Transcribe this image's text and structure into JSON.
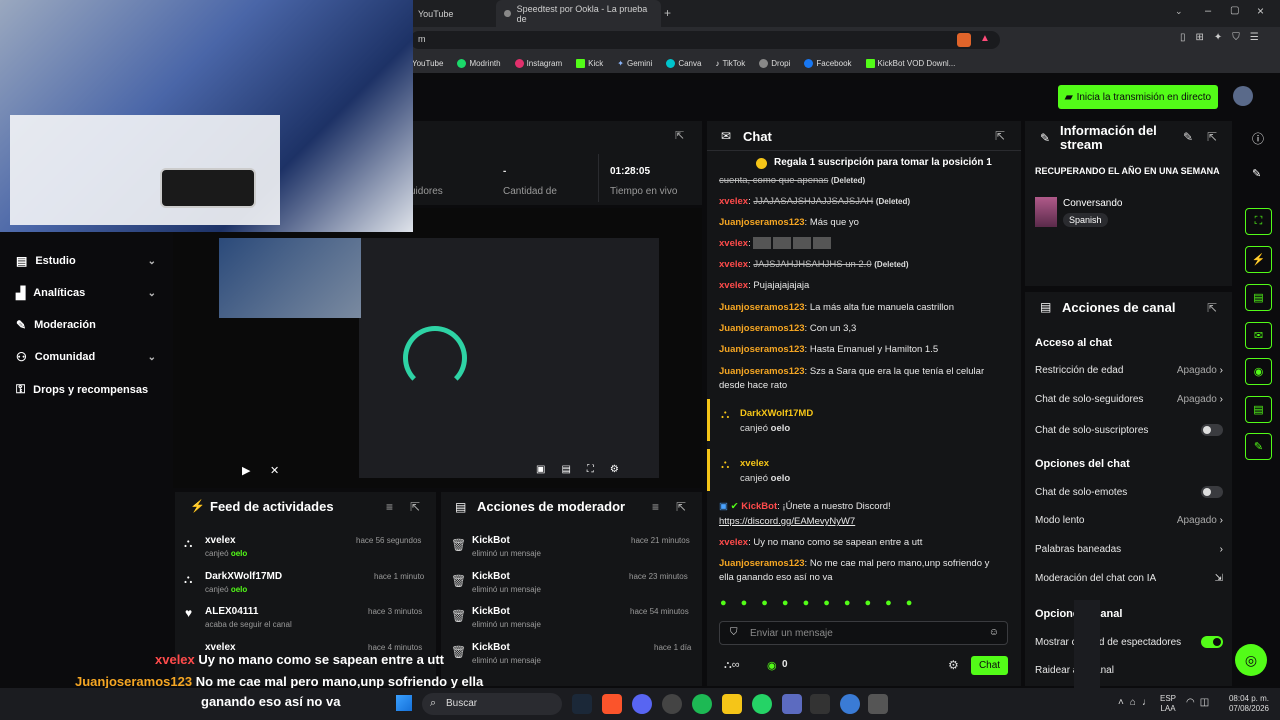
{
  "browser": {
    "tab1": "YouTube",
    "tab2": "Speedtest por Ookla - La prueba de",
    "url": "m",
    "bookmarks": [
      "YouTube",
      "Modrinth",
      "Instagram",
      "Kick",
      "Gemini",
      "Canva",
      "TikTok",
      "Dropi",
      "Facebook",
      "KickBot VOD Downl..."
    ]
  },
  "header": {
    "go_live": "Inicia la transmisión en directo"
  },
  "sidebar": {
    "items": [
      {
        "label": "Estudio",
        "chev": true
      },
      {
        "label": "Analíticas",
        "chev": true
      },
      {
        "label": "Moderación",
        "chev": false
      },
      {
        "label": "Comunidad",
        "chev": true
      },
      {
        "label": "Drops y recompensas",
        "chev": false
      }
    ]
  },
  "stats": {
    "followers_label": "uidores",
    "dash": "-",
    "count_label": "Cantidad de",
    "time_value": "01:28:05",
    "time_label": "Tiempo en vivo"
  },
  "feed": {
    "title": "Feed de actividades",
    "items": [
      {
        "name": "xvelex",
        "action": "canjeó",
        "reward": "oelo",
        "time": "hace 56 segundos"
      },
      {
        "name": "DarkXWolf17MD",
        "action": "canjeó",
        "reward": "oelo",
        "time": "hace 1 minuto"
      },
      {
        "name": "ALEX04111",
        "action": "acaba de seguir el canal",
        "reward": "",
        "time": "hace 3 minutos"
      },
      {
        "name": "xvelex",
        "action": "",
        "reward": "",
        "time": "hace 4 minutos"
      }
    ]
  },
  "modactions": {
    "title": "Acciones de moderador",
    "items": [
      {
        "name": "KickBot",
        "action": "eliminó un mensaje",
        "time": "hace 21 minutos"
      },
      {
        "name": "KickBot",
        "action": "eliminó un mensaje",
        "time": "hace 23 minutos"
      },
      {
        "name": "KickBot",
        "action": "eliminó un mensaje",
        "time": "hace 54 minutos"
      },
      {
        "name": "KickBot",
        "action": "eliminó un mensaje",
        "time": "hace 1 día"
      }
    ]
  },
  "chat": {
    "title": "Chat",
    "pinned": "Regala 1 suscripción para tomar la posición 1",
    "deleted_tag": "(Deleted)",
    "messages": [
      {
        "user": "",
        "text": "cuenta, como que apenas",
        "deleted": true
      },
      {
        "user": "xvelex",
        "text": "JJAJASAJSHJAJJSAJSJAH",
        "deleted": true
      },
      {
        "user": "Juanjoseramos123",
        "text": "Más que yo",
        "deleted": false
      },
      {
        "user": "xvelex",
        "text": "",
        "deleted": false
      },
      {
        "user": "xvelex",
        "text": "JAJSJAHJHSAHJHS un 2.0",
        "deleted": true
      },
      {
        "user": "xvelex",
        "text": "Pujajajajajaja",
        "deleted": false
      },
      {
        "user": "Juanjoseramos123",
        "text": "La más alta fue manuela castrillon",
        "deleted": false
      },
      {
        "user": "Juanjoseramos123",
        "text": "Con un 3,3",
        "deleted": false
      },
      {
        "user": "Juanjoseramos123",
        "text": "Hasta Emanuel y Hamilton 1.5",
        "deleted": false
      },
      {
        "user": "Juanjoseramos123",
        "text": "Szs a Sara que era la que tenía el celular desde hace rato",
        "deleted": false
      }
    ],
    "redeems": [
      {
        "user": "DarkXWolf17MD",
        "action": "canjeó",
        "reward": "oelo"
      },
      {
        "user": "xvelex",
        "action": "canjeó",
        "reward": "oelo"
      }
    ],
    "bot": {
      "user": "KickBot",
      "text": "¡Únete a nuestro Discord!",
      "link": "https://discord.gg/EAMevyNyW7"
    },
    "after": [
      {
        "user": "xvelex",
        "text": "Uy no mano como se sapean entre a utt"
      },
      {
        "user": "Juanjoseramos123",
        "text": "No me cae mal pero mano,unp sofriendo y ella ganando eso así no va"
      }
    ],
    "placeholder": "Enviar un mensaje",
    "points": "0",
    "send": "Chat"
  },
  "streaminfo": {
    "title": "Información del stream",
    "stream_title": "RECUPERANDO EL AÑO EN UNA SEMANA",
    "category": "Conversando",
    "language": "Spanish"
  },
  "channel": {
    "title": "Acciones de canal",
    "chat_access": "Acceso al chat",
    "rows1": [
      {
        "label": "Restricción de edad",
        "value": "Apagado",
        "type": "chev"
      },
      {
        "label": "Chat de solo-seguidores",
        "value": "Apagado",
        "type": "chev"
      },
      {
        "label": "Chat de solo-suscriptores",
        "value": "",
        "type": "toggle-off"
      }
    ],
    "chat_options": "Opciones del chat",
    "rows2": [
      {
        "label": "Chat de solo-emotes",
        "value": "",
        "type": "toggle-off"
      },
      {
        "label": "Modo lento",
        "value": "Apagado",
        "type": "chev"
      },
      {
        "label": "Palabras baneadas",
        "value": "",
        "type": "chev"
      },
      {
        "label": "Moderación del chat con IA",
        "value": "",
        "type": "ext"
      }
    ],
    "channel_options": "Opcione   l canal",
    "rows3": [
      {
        "label": "Mostrar c      ad de espectadores",
        "value": "",
        "type": "toggle-on"
      },
      {
        "label": "Raidear a      anal",
        "value": "",
        "type": "none"
      }
    ]
  },
  "overlay": {
    "line1_user": "xvelex",
    "line1_text": "Uy no mano como se sapean entre a utt",
    "line2_user": "Juanjoseramos123",
    "line2_text": "No me cae mal pero mano,unp sofriendo y ella",
    "line3_text": "ganando eso así no va"
  },
  "taskbar": {
    "search": "Buscar",
    "lang1": "ESP",
    "lang2": "LAA",
    "time": "08:04 p. m.",
    "date": "07/08/2026"
  }
}
